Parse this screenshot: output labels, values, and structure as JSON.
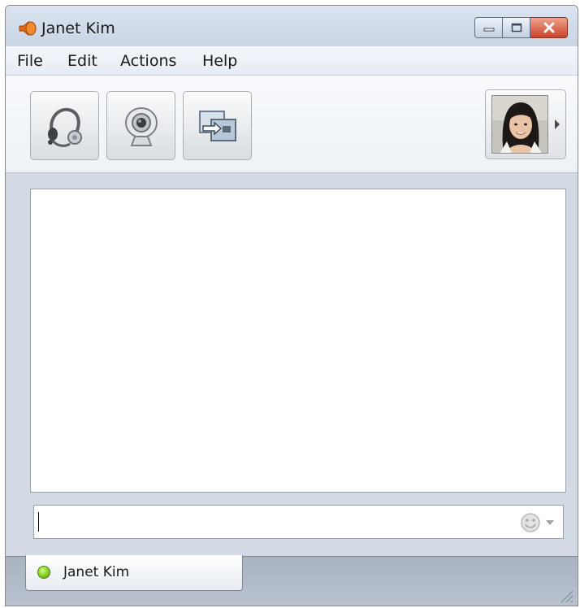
{
  "window": {
    "title": "Janet Kim",
    "controls": [
      "minimize",
      "maximize",
      "close"
    ]
  },
  "menu": {
    "file": "File",
    "edit": "Edit",
    "actions": "Actions",
    "help": "Help"
  },
  "toolbar": {
    "buttons": [
      {
        "icon": "headset-icon",
        "action": "voice-call"
      },
      {
        "icon": "webcam-icon",
        "action": "video-call"
      },
      {
        "icon": "share-screen-icon",
        "action": "share"
      }
    ],
    "avatar": {
      "icon": "contact-photo"
    }
  },
  "compose": {
    "value": "",
    "emoticon_icon": "smiley-icon"
  },
  "tabs": [
    {
      "label": "Janet Kim",
      "status": "online",
      "status_color": "#7ac81d"
    }
  ],
  "colors": {
    "close_button": "#c9432b",
    "online": "#7ac81d"
  }
}
